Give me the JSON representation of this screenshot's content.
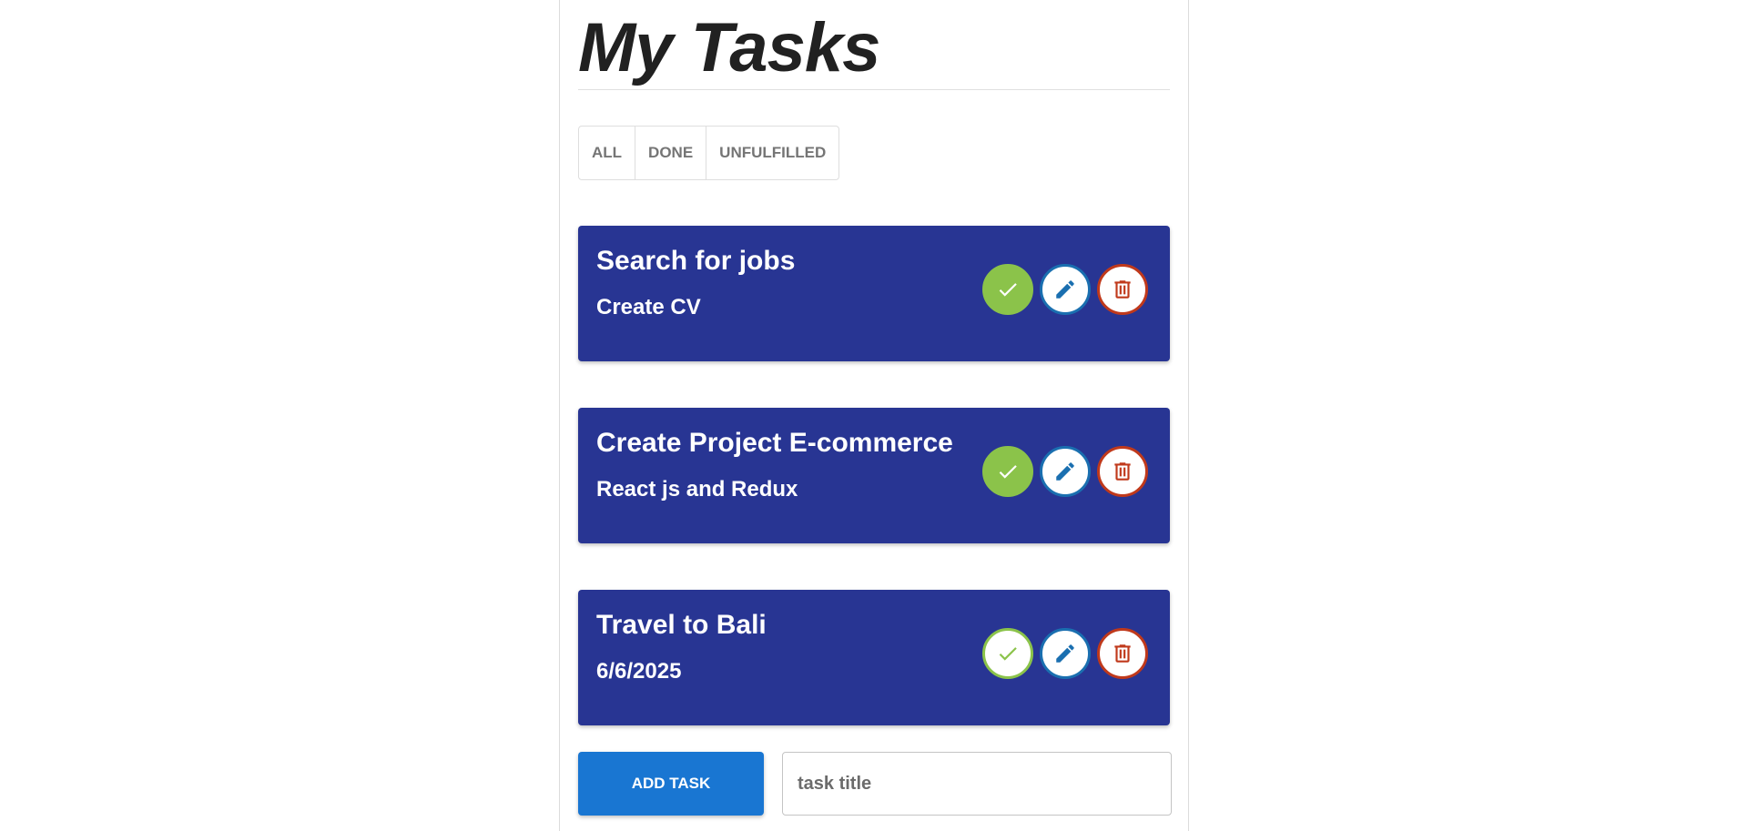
{
  "header": {
    "title": "My Tasks"
  },
  "filters": [
    {
      "label": "ALL"
    },
    {
      "label": "DONE"
    },
    {
      "label": "UNFULFILLED"
    }
  ],
  "tasks": [
    {
      "title": "Search for jobs",
      "description": "Create CV",
      "done": true
    },
    {
      "title": "Create Project E-commerce",
      "description": "React js and Redux",
      "done": true
    },
    {
      "title": "Travel to Bali",
      "description": "6/6/2025",
      "done": false
    }
  ],
  "add_task": {
    "button_label": "ADD TASK",
    "input_placeholder": "task title",
    "input_value": ""
  },
  "colors": {
    "card_background": "#283593",
    "done_green": "#8bc34a",
    "edit_blue": "#1a6fb0",
    "delete_red": "#c0391b",
    "add_button_blue": "#1976d2"
  },
  "icons": {
    "done": "check-icon",
    "edit": "pencil-icon",
    "delete": "trash-icon"
  }
}
